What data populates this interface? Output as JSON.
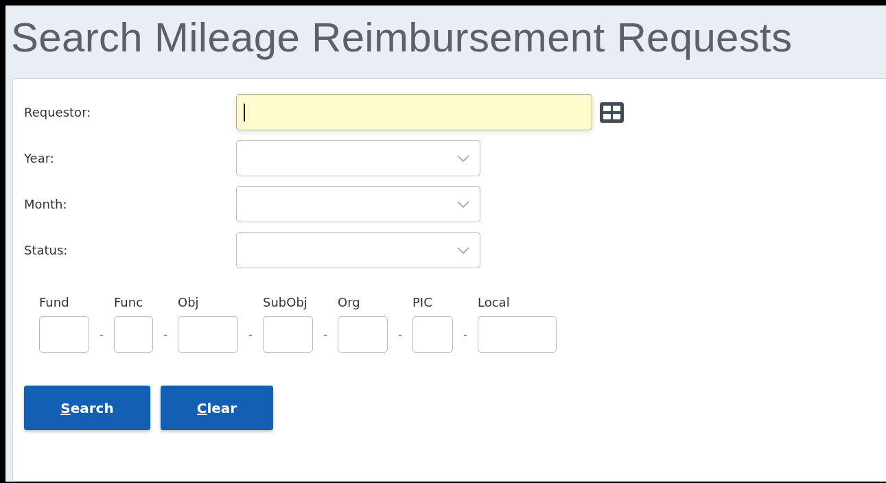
{
  "page": {
    "title": "Search Mileage Reimbursement Requests"
  },
  "form": {
    "requestor": {
      "label": "Requestor:",
      "focused": true
    },
    "selects": [
      {
        "label": "Year:"
      },
      {
        "label": "Month:"
      },
      {
        "label": "Status:"
      }
    ],
    "account": {
      "separator": "-",
      "segments": [
        {
          "label": "Fund"
        },
        {
          "label": "Func"
        },
        {
          "label": "Obj"
        },
        {
          "label": "SubObj"
        },
        {
          "label": "Org"
        },
        {
          "label": "PIC"
        },
        {
          "label": "Local"
        }
      ]
    },
    "buttons": [
      {
        "label": "Search",
        "underline_first": true
      },
      {
        "label": "Clear",
        "underline_first": true
      }
    ]
  }
}
